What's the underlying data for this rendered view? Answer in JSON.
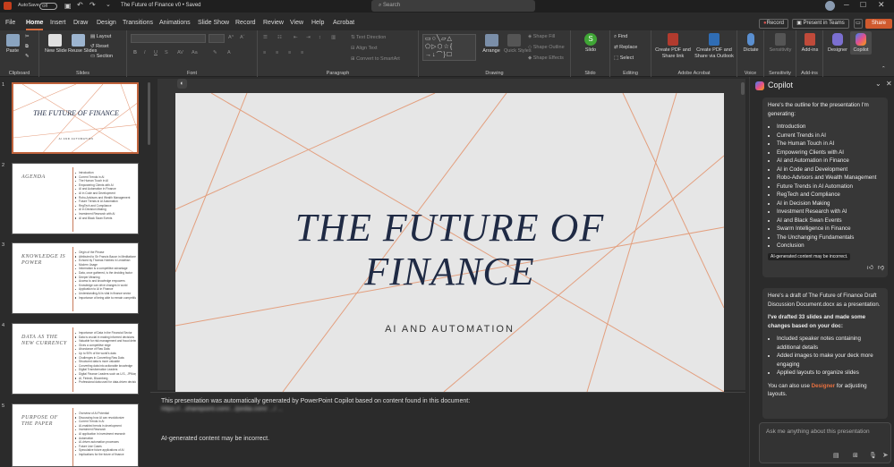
{
  "titlebar": {
    "autosave_label": "AutoSave",
    "autosave_state": "Off",
    "doc_title": "The Future of Finance v0",
    "saved_status": "Saved",
    "search_placeholder": "Search"
  },
  "menu": {
    "tabs": [
      "File",
      "Home",
      "Insert",
      "Draw",
      "Design",
      "Transitions",
      "Animations",
      "Slide Show",
      "Record",
      "Review",
      "View",
      "Help",
      "Acrobat"
    ],
    "active_tab": "Home",
    "record_button": "Record",
    "present_button": "Present in Teams",
    "share_button": "Share"
  },
  "ribbon": {
    "clipboard": {
      "label": "Clipboard",
      "paste": "Paste"
    },
    "slides": {
      "label": "Slides",
      "new_slide": "New Slide",
      "reuse_slides": "Reuse Slides",
      "layout": "Layout",
      "reset": "Reset",
      "section": "Section"
    },
    "font": {
      "label": "Font"
    },
    "paragraph": {
      "label": "Paragraph",
      "text_direction": "Text Direction",
      "align_text": "Align Text",
      "convert_smartart": "Convert to SmartArt"
    },
    "drawing": {
      "label": "Drawing",
      "arrange": "Arrange",
      "quick_styles": "Quick Styles",
      "shape_fill": "Shape Fill",
      "shape_outline": "Shape Outline",
      "shape_effects": "Shape Effects"
    },
    "slido": {
      "label": "Slido",
      "button": "Slido"
    },
    "editing": {
      "label": "Editing",
      "find": "Find",
      "replace": "Replace",
      "select": "Select"
    },
    "acrobat": {
      "label": "Adobe Acrobat",
      "create_pdf_share": "Create PDF and Share link",
      "create_pdf_outlook": "Create PDF and Share via Outlook"
    },
    "voice": {
      "label": "Voice",
      "dictate": "Dictate"
    },
    "sensitivity": {
      "label": "Sensitivity",
      "button": "Sensitivity"
    },
    "addins": {
      "label": "Add-ins",
      "button": "Add-ins"
    },
    "designer": "Designer",
    "copilot": "Copilot"
  },
  "thumbnails": [
    {
      "num": "1",
      "title": "THE FUTURE OF FINANCE",
      "subtitle": "AI AND AUTOMATION",
      "bullets": []
    },
    {
      "num": "2",
      "title": "AGENDA",
      "bullets": [
        "Introduction",
        "Current Trends in AI",
        "The Human Touch in AI",
        "Empowering Clients with AI",
        "AI and Automation in Finance",
        "AI in Code and Development",
        "Robo-Advisors and Wealth Management",
        "Future Trends in AI Automation",
        "RegTech and Compliance",
        "AI in Decision Making",
        "Investment Research with AI",
        "AI and Black Swan Events"
      ]
    },
    {
      "num": "3",
      "title": "KNOWLEDGE IS POWER",
      "bullets": [
        "Origin of the Phrase",
        "Attributed to Sir Francis Bacon in Meditationes Sacrae",
        "Echoed by Thomas Hobbes in Leviathan",
        "Modern Usage",
        "Information is a competitive advantage",
        "Data, once gathered, is the deciding factor",
        "Deeper Meaning",
        "Access to and knowledge empowers",
        "Knowledge can drive changes in world",
        "Application to AI in Finance",
        "Understanding AI is vital in finance sector",
        "Importance of being able to remain competitive"
      ]
    },
    {
      "num": "4",
      "title": "DATA AS THE NEW CURRENCY",
      "bullets": [
        "Importance of Data in the Financial Sector",
        "Data is crucial in making informed decisions",
        "Valuable for risk management and fraud detection",
        "Gives a competitive edge",
        "Abundance of Raw Data",
        "Up to 90% of the world's data",
        "Challenges in Converting Raw Data",
        "Structured data is more valuable",
        "Converting data into actionable knowledge",
        "Digital Transformation Leaders",
        "Digital Finance Leaders such as U.S., JPMorgan Chase",
        "AI, Fintech, Bloomberg",
        "Professional data used for data-driven decisions"
      ]
    },
    {
      "num": "5",
      "title": "PURPOSE OF THE PAPER",
      "bullets": [
        "Overview of AI Potential",
        "Discussing how AI can revolutionize",
        "Current Trends in AI",
        "AI-enabled trends in development",
        "Investment Research",
        "AI application in investment research",
        "Automation",
        "AI-driven automation processes",
        "Future Use Cases",
        "Speculative future applications of AI",
        "Implications for the future of finance"
      ]
    }
  ],
  "slide": {
    "title": "THE FUTURE OF FINANCE",
    "subtitle": "AI AND AUTOMATION"
  },
  "notes": {
    "line1": "This presentation was automatically generated by PowerPoint Copilot based on content found in this document:",
    "line2": "https://...sharepoint.com/.../pedia.com/ .../ ...",
    "disclaimer": "AI-generated content may be incorrect."
  },
  "copilot": {
    "header": "Copilot",
    "outline_intro": "Here's the outline for the presentation I'm generating:",
    "outline_items": [
      "Introduction",
      "Current Trends in AI",
      "The Human Touch in AI",
      "Empowering Clients with AI",
      "AI and Automation in Finance",
      "AI in Code and Development",
      "Robo-Advisors and Wealth Management",
      "Future Trends in AI Automation",
      "RegTech and Compliance",
      "AI in Decision Making",
      "Investment Research with AI",
      "AI and Black Swan Events",
      "Swarm Intelligence in Finance",
      "The Unchanging Fundamentals",
      "Conclusion"
    ],
    "disclaimer": "AI-generated content may be incorrect.",
    "draft_msg": "Here's a draft of The Future of Finance Draft Discussion Document.docx as a presentation.",
    "changes_intro": "I've drafted 33 slides and made some changes based on your doc:",
    "changes": [
      "Included speaker notes containing additional details",
      "Added images to make your deck more engaging",
      "Applied layouts to organize slides"
    ],
    "designer_pre": "You can also use ",
    "designer_link": "Designer",
    "designer_post": " for adjusting layouts.",
    "input_placeholder": "Ask me anything about this presentation"
  },
  "colors": {
    "accent": "#c0633c",
    "slide_title": "#1f2a44",
    "slido": "#3fa535",
    "share": "#d05a2e"
  }
}
